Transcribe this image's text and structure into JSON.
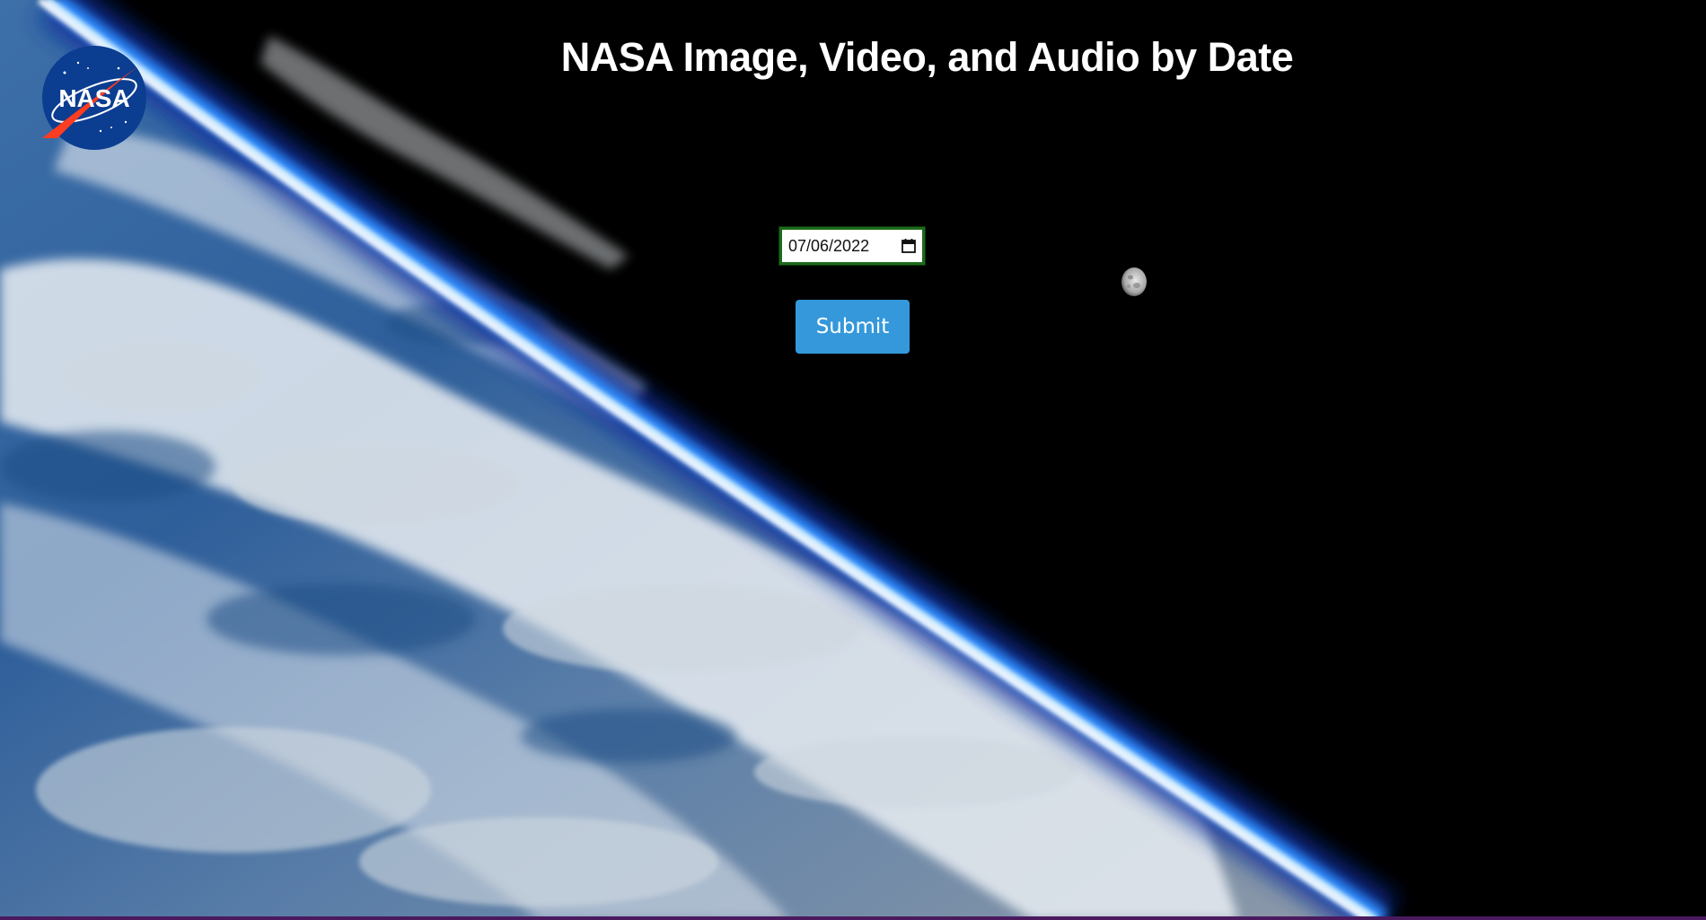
{
  "header": {
    "title": "NASA Image, Video, and Audio by Date"
  },
  "logo": {
    "text": "NASA",
    "icon": "nasa-meatball-logo"
  },
  "form": {
    "date_value": "07/06/2022",
    "calendar_icon": "calendar-icon",
    "submit_label": "Submit"
  },
  "background": {
    "description_icon": "earth-horizon-image",
    "moon_icon": "moon-icon"
  },
  "colors": {
    "button": "#3498db",
    "date_border": "#1c6b1c",
    "space": "#000000",
    "atmosphere": "#2f8cff",
    "bottom_bar": "#4b1a5e"
  }
}
